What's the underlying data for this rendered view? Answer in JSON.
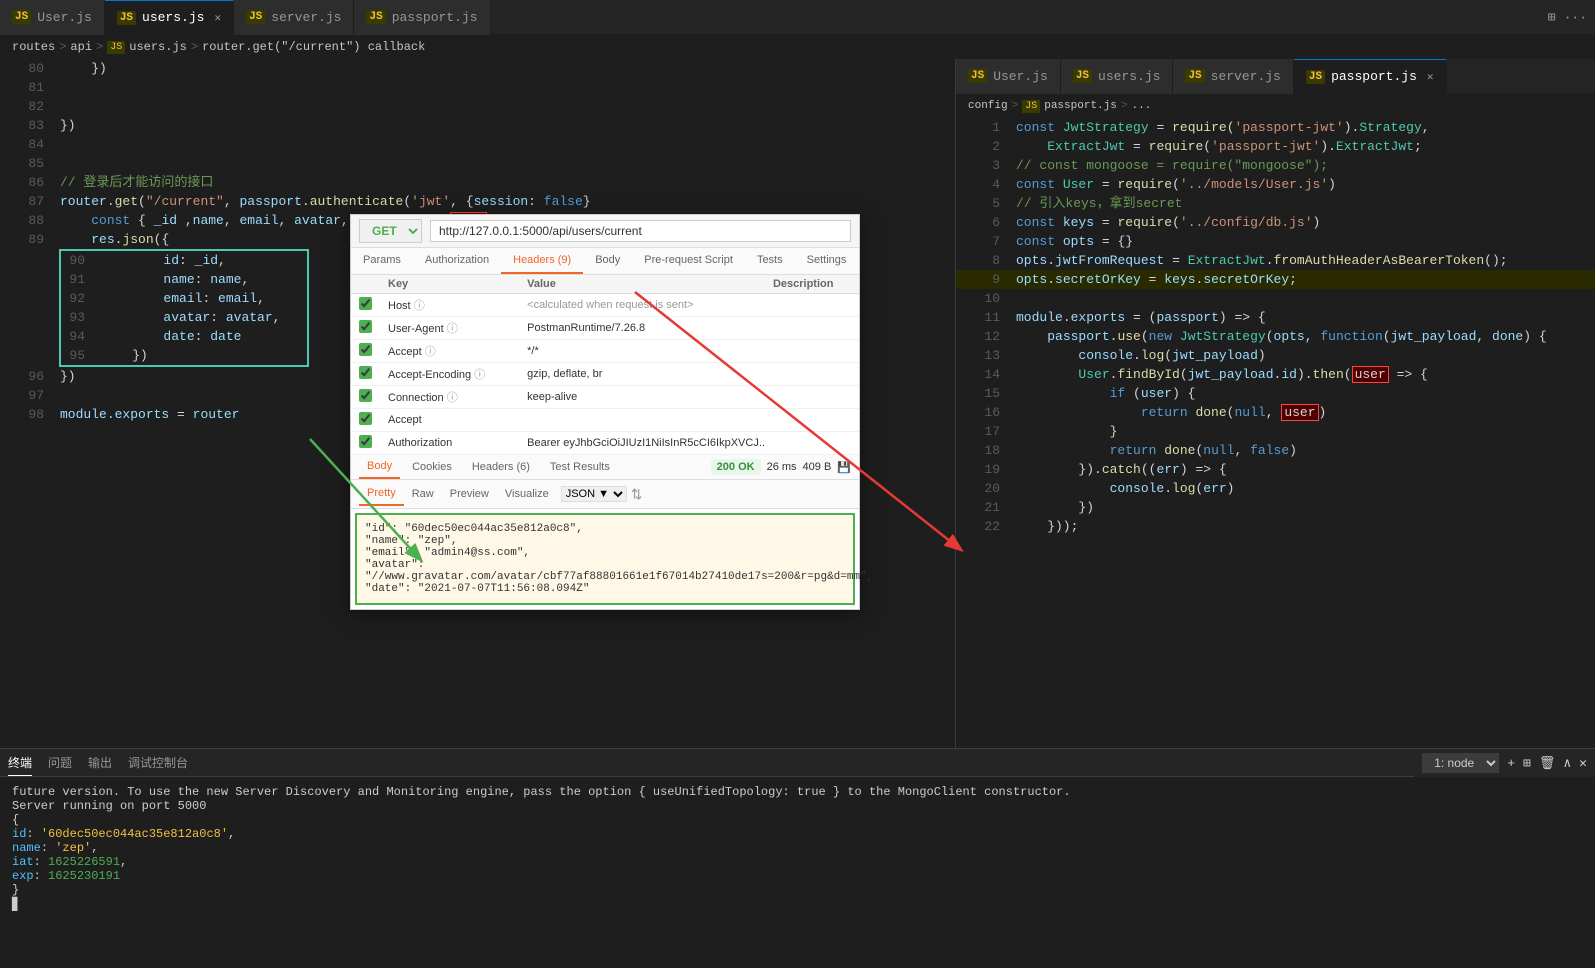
{
  "tabs": {
    "main": [
      {
        "id": "user-js",
        "label": "User.js",
        "icon": "JS",
        "active": false,
        "closeable": false
      },
      {
        "id": "users-js",
        "label": "users.js",
        "icon": "JS",
        "active": true,
        "closeable": true
      },
      {
        "id": "server-js",
        "label": "server.js",
        "icon": "JS",
        "active": false,
        "closeable": false
      },
      {
        "id": "passport-js",
        "label": "passport.js",
        "icon": "JS",
        "active": false,
        "closeable": false
      }
    ],
    "second": [
      {
        "id": "user-js-2",
        "label": "User.js",
        "icon": "JS",
        "active": false
      },
      {
        "id": "users-js-2",
        "label": "users.js",
        "icon": "JS",
        "active": false
      },
      {
        "id": "server-js-2",
        "label": "server.js",
        "icon": "JS",
        "active": false
      },
      {
        "id": "passport-js-2",
        "label": "passport.js",
        "icon": "JS",
        "active": true,
        "closeable": true
      }
    ]
  },
  "breadcrumb": {
    "main": [
      "routes",
      "api",
      "users.js",
      "router.get(\"/current\") callback"
    ],
    "second": [
      "config",
      "passport.js",
      "..."
    ]
  },
  "code": {
    "lines": [
      {
        "num": 80,
        "content": "    })"
      },
      {
        "num": 81,
        "content": ""
      },
      {
        "num": 82,
        "content": ""
      },
      {
        "num": 83,
        "content": "})"
      },
      {
        "num": 84,
        "content": ""
      },
      {
        "num": 85,
        "content": ""
      },
      {
        "num": 86,
        "content": "// 登录后才能访问的接口"
      },
      {
        "num": 87,
        "content": "router.get(\"/current\", passport.authenticate('jwt', {session: false}"
      },
      {
        "num": 88,
        "content": "    const { _id ,name, email, avatar, date} = req.user"
      },
      {
        "num": 89,
        "content": "    res.json({"
      },
      {
        "num": 90,
        "content": "        id: _id,"
      },
      {
        "num": 91,
        "content": "        name: name,"
      },
      {
        "num": 92,
        "content": "        email: email,"
      },
      {
        "num": 93,
        "content": "        avatar: avatar,"
      },
      {
        "num": 94,
        "content": "        date: date"
      },
      {
        "num": 95,
        "content": "    })"
      },
      {
        "num": 96,
        "content": "})"
      },
      {
        "num": 97,
        "content": ""
      },
      {
        "num": 98,
        "content": "module.exports = router"
      }
    ]
  },
  "passport_code": {
    "lines": [
      {
        "num": 1,
        "content": "const JwtStrategy = require('passport-jwt').Strategy,"
      },
      {
        "num": 2,
        "content": "    ExtractJwt = require('passport-jwt').ExtractJwt;"
      },
      {
        "num": 3,
        "content": "// const mongoose = require(\"mongoose\");"
      },
      {
        "num": 4,
        "content": "const User = require('../models/User.js')"
      },
      {
        "num": 5,
        "content": "// 引入keys，拿到secret"
      },
      {
        "num": 6,
        "content": "const keys = require('../config/db.js')"
      },
      {
        "num": 7,
        "content": "const opts = {}"
      },
      {
        "num": 8,
        "content": "opts.jwtFromRequest = ExtractJwt.fromAuthHeaderAsBearerToken();"
      },
      {
        "num": 9,
        "content": "opts.secretOrKey = keys.secretOrKey;"
      },
      {
        "num": 10,
        "content": ""
      },
      {
        "num": 11,
        "content": "module.exports = (passport) => {"
      },
      {
        "num": 12,
        "content": "    passport.use(new JwtStrategy(opts, function(jwt_payload, done) {"
      },
      {
        "num": 13,
        "content": "        console.log(jwt_payload)"
      },
      {
        "num": 14,
        "content": "        User.findById(jwt_payload.id).then(user => {"
      },
      {
        "num": 15,
        "content": "            if (user) {"
      },
      {
        "num": 16,
        "content": "                return done(null, user)"
      },
      {
        "num": 17,
        "content": "            }"
      },
      {
        "num": 18,
        "content": "            return done(null, false)"
      },
      {
        "num": 19,
        "content": "        }).catch((err) => {"
      },
      {
        "num": 20,
        "content": "            console.log(err)"
      },
      {
        "num": 21,
        "content": "        })"
      },
      {
        "num": 22,
        "content": "    }));"
      }
    ]
  },
  "postman": {
    "method": "GET",
    "url": "http://127.0.0.1:5000/api/users/current",
    "tabs": [
      "Params",
      "Authorization",
      "Headers (9)",
      "Body",
      "Pre-request Script",
      "Tests",
      "Settings"
    ],
    "active_tab": "Headers (9)",
    "headers_note": "<calculated when request is sent>",
    "headers": [
      {
        "checked": true,
        "key": "Host",
        "value": "<calculated when request is sent>"
      },
      {
        "checked": true,
        "key": "User-Agent",
        "value": "PostmanRuntime/7.26.8"
      },
      {
        "checked": true,
        "key": "Accept",
        "value": "*/*"
      },
      {
        "checked": true,
        "key": "Accept-Encoding",
        "value": "gzip, deflate, br"
      },
      {
        "checked": true,
        "key": "Connection",
        "value": "keep-alive"
      },
      {
        "checked": true,
        "key": "Accept",
        "value": ""
      },
      {
        "checked": true,
        "key": "Authorization",
        "value": "Bearer eyJhbGciOiJIUzI1NiIsInR5cCI6IkpXVCJ..."
      }
    ],
    "body_tabs": [
      "Body",
      "Cookies",
      "Headers (6)",
      "Test Results"
    ],
    "active_body_tab": "Body",
    "format_tabs": [
      "Pretty",
      "Raw",
      "Preview",
      "Visualize"
    ],
    "active_format": "Pretty",
    "status": "200 OK",
    "time": "26 ms",
    "size": "409 B",
    "response": {
      "id": "60dec50ec044ac35e812a0c8",
      "name": "zep",
      "email": "admin4@ss.com",
      "avatar": "//www.gravatar.com/avatar/cbf77af88801661e1f67014b27410de17s=200&r=pg&d=mm",
      "date": "2021-07-07T11:56:08.094Z"
    }
  },
  "terminal": {
    "tabs": [
      "终端",
      "问题",
      "输出",
      "调试控制台"
    ],
    "active_tab": "终端",
    "content": [
      "future version. To use the new Server Discovery and Monitoring engine, pass the option { useUnifiedTopology: true } to the MongoClient constructor.",
      "Server running on port 5000",
      "{",
      "  id: '60dec50ec044ac35e812a0c8',",
      "  name: 'zep',",
      "  iat: 1625226591,",
      "  exp: 1625230191",
      "}"
    ],
    "select_label": "1: node"
  }
}
